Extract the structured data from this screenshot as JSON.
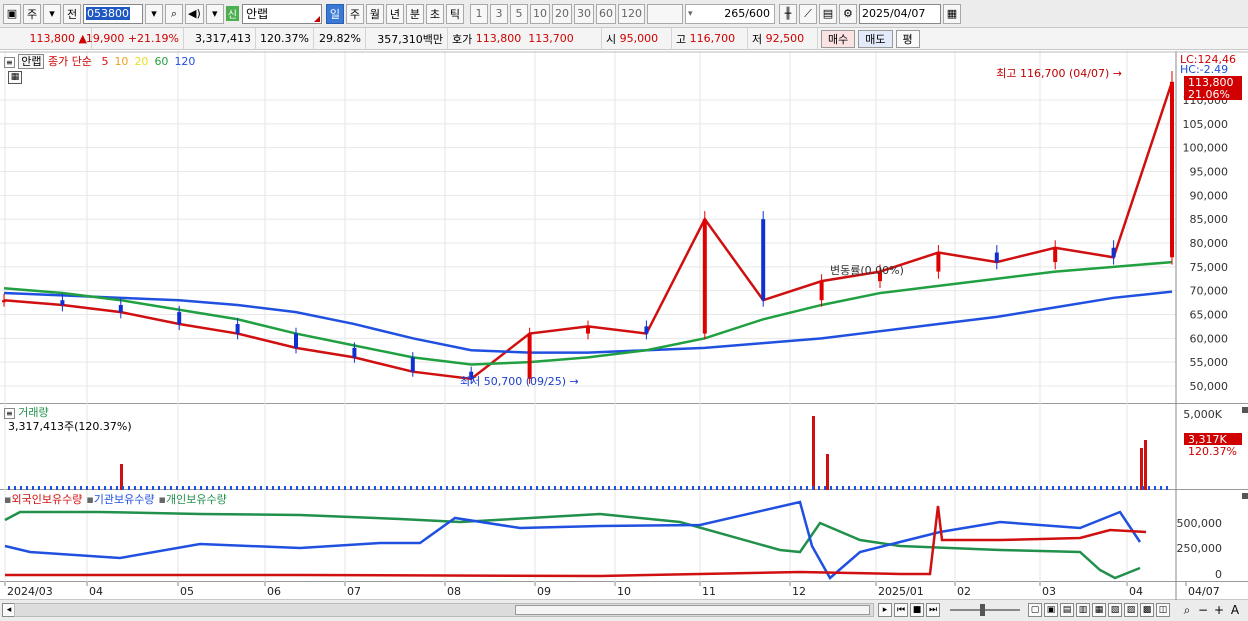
{
  "toolbar": {
    "market": "주",
    "prefix": "전",
    "code": "053800",
    "badge": "신",
    "name": "안랩",
    "periods": [
      "일",
      "주",
      "월",
      "년",
      "분",
      "초",
      "틱"
    ],
    "selected_period": "일",
    "minutes": [
      "1",
      "3",
      "5",
      "10",
      "20",
      "30",
      "60",
      "120"
    ],
    "count": "265",
    "count_total": "/600",
    "date": "2025/04/07"
  },
  "info": {
    "price": "113,800",
    "arrow": "▲",
    "change": "19,900",
    "change_pct": "+21.19%",
    "volume": "3,317,413",
    "vol_ratio": "120.37%",
    "turnover": "29.82%",
    "amount": "357,310백만",
    "quote_label": "호가",
    "ask": "113,800",
    "bid": "113,700",
    "open_label": "시",
    "open": "95,000",
    "high_label": "고",
    "high": "116,700",
    "low_label": "저",
    "low": "92,500",
    "buy_btn": "매수",
    "sell_btn": "매도",
    "eval_btn": "평"
  },
  "main_chart": {
    "stock_label": "안랩",
    "ma_label": "종가 단순",
    "ma_periods": [
      "5",
      "10",
      "20",
      "60",
      "120"
    ],
    "ma_colors": [
      "#e01010",
      "#f0a020",
      "#e8e020",
      "#20a040",
      "#2050e0"
    ],
    "price_axis": [
      "110,000",
      "105,000",
      "100,000",
      "95,000",
      "90,000",
      "85,000",
      "80,000",
      "75,000",
      "70,000",
      "65,000",
      "60,000",
      "55,000",
      "50,000"
    ],
    "lc_label": "LC:124,46",
    "hc_label": "HC:-2.49",
    "last_price_tag": "113,800",
    "last_pct_tag": "21.06%",
    "high_annotation": "최고 116,700 (04/07)",
    "low_annotation": "최저 50,700 (09/25)",
    "mid_annotation": "변동률(0.00%)"
  },
  "volume_chart": {
    "title": "거래량",
    "value": "3,317,413주(120.37%)",
    "axis_top": "5,000K",
    "tag_value": "3,317K",
    "tag_pct": "120.37%"
  },
  "holding_chart": {
    "legend": [
      "외국인보유수량",
      "기관보유수량",
      "개인보유수량"
    ],
    "legend_colors": [
      "#d01010",
      "#2050e0",
      "#20904a"
    ],
    "axis": [
      "500,000",
      "250,000",
      "0"
    ]
  },
  "chart_data": {
    "type": "line",
    "title": "",
    "x_ticks": [
      "2024/03",
      "04",
      "05",
      "06",
      "07",
      "08",
      "09",
      "10",
      "11",
      "12",
      "2025/01",
      "02",
      "03",
      "04",
      "04/07"
    ],
    "series": [
      {
        "name": "종가",
        "values": [
          68000,
          67000,
          65500,
          63000,
          61000,
          58000,
          56000,
          53000,
          51500,
          61000,
          62500,
          61000,
          85000,
          68000,
          72000,
          74000,
          78000,
          76000,
          79000,
          77000,
          113800
        ]
      },
      {
        "name": "120",
        "values": [
          69500,
          69000,
          68500,
          68000,
          67000,
          65500,
          63000,
          60000,
          57500,
          57000,
          57000,
          57500,
          58000,
          59000,
          60000,
          61500,
          63000,
          64500,
          66500,
          68500,
          69800
        ]
      },
      {
        "name": "60",
        "values": [
          70500,
          69500,
          68000,
          66000,
          64000,
          61000,
          58500,
          56000,
          54500,
          55000,
          56000,
          57500,
          60000,
          64000,
          67000,
          69500,
          71000,
          72500,
          74000,
          75000,
          76000
        ]
      }
    ],
    "ylim": [
      48000,
      125000
    ],
    "high": {
      "value": 116700,
      "date": "04/07"
    },
    "low": {
      "value": 50700,
      "date": "09/25"
    }
  }
}
